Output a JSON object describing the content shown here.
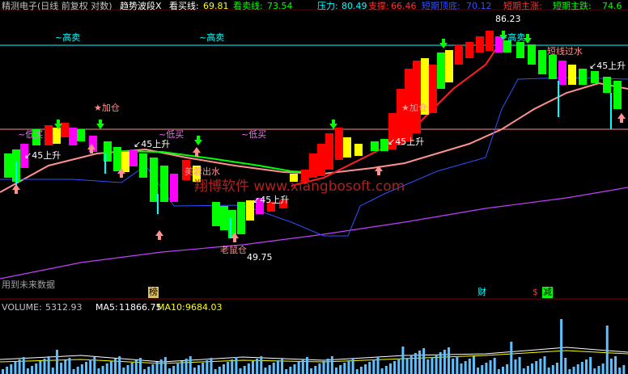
{
  "colors": {
    "background": "#000000",
    "red": "#ff0000",
    "yellow": "#ffff00",
    "green": "#00ff00",
    "magenta": "#ff00ff",
    "cyan": "#00ffff",
    "blue": "#3050ff",
    "salmon": "#ff9090",
    "pink": "#ff66ff",
    "violet": "#c040ff"
  },
  "header": {
    "title": "精测电子(日线 前复权 对数)",
    "indicator": "趋势波段X",
    "buy_line_label": "看买线:",
    "buy_line_value": "69.81",
    "sell_line_label": "看卖线:",
    "sell_line_value": "73.54",
    "pressure_label": "压力:",
    "pressure_value": "80.49",
    "support_label": "支撑:",
    "support_value": "66.46",
    "short_top_label": "短期顶底:",
    "short_top_value": "70.12",
    "short_up_label": "短期主涨:",
    "short_down_label": "短期主跌:",
    "short_down_value": "74.6"
  },
  "annotations": {
    "high_sell_1": "~高卖",
    "high_sell_2": "~高卖",
    "high_sell_3": "~高卖",
    "low_buy_1": "~低买",
    "low_buy_2": "~低买",
    "low_buy_3": "~低买",
    "add_pos_1": "★加仓",
    "add_pos_2": "★加仓",
    "old_add": "老鼠仓",
    "rise_1": "↙45上升",
    "rise_2": "↙45上升",
    "rise_3": "↙45上升",
    "rise_4": "↙45上升",
    "rise_5": "↙45上升",
    "over_water_1": "美蓉出水",
    "over_water_2": "短线过水",
    "price_high": "86.23",
    "price_low": "49.75",
    "watermark": "翔博软件 www.xiangbosoft.com",
    "future_data": "用到未来数据",
    "tag_bang": "榜",
    "tag_cai": "财",
    "tag_dollar": "$",
    "tag_jian": "减"
  },
  "volume": {
    "label": "VOLUME:",
    "value": "5312.93",
    "ma5_label": "MA5:",
    "ma5_value": "11866.75",
    "ma10_label": "MA10:",
    "ma10_value": "9684.03"
  }
}
